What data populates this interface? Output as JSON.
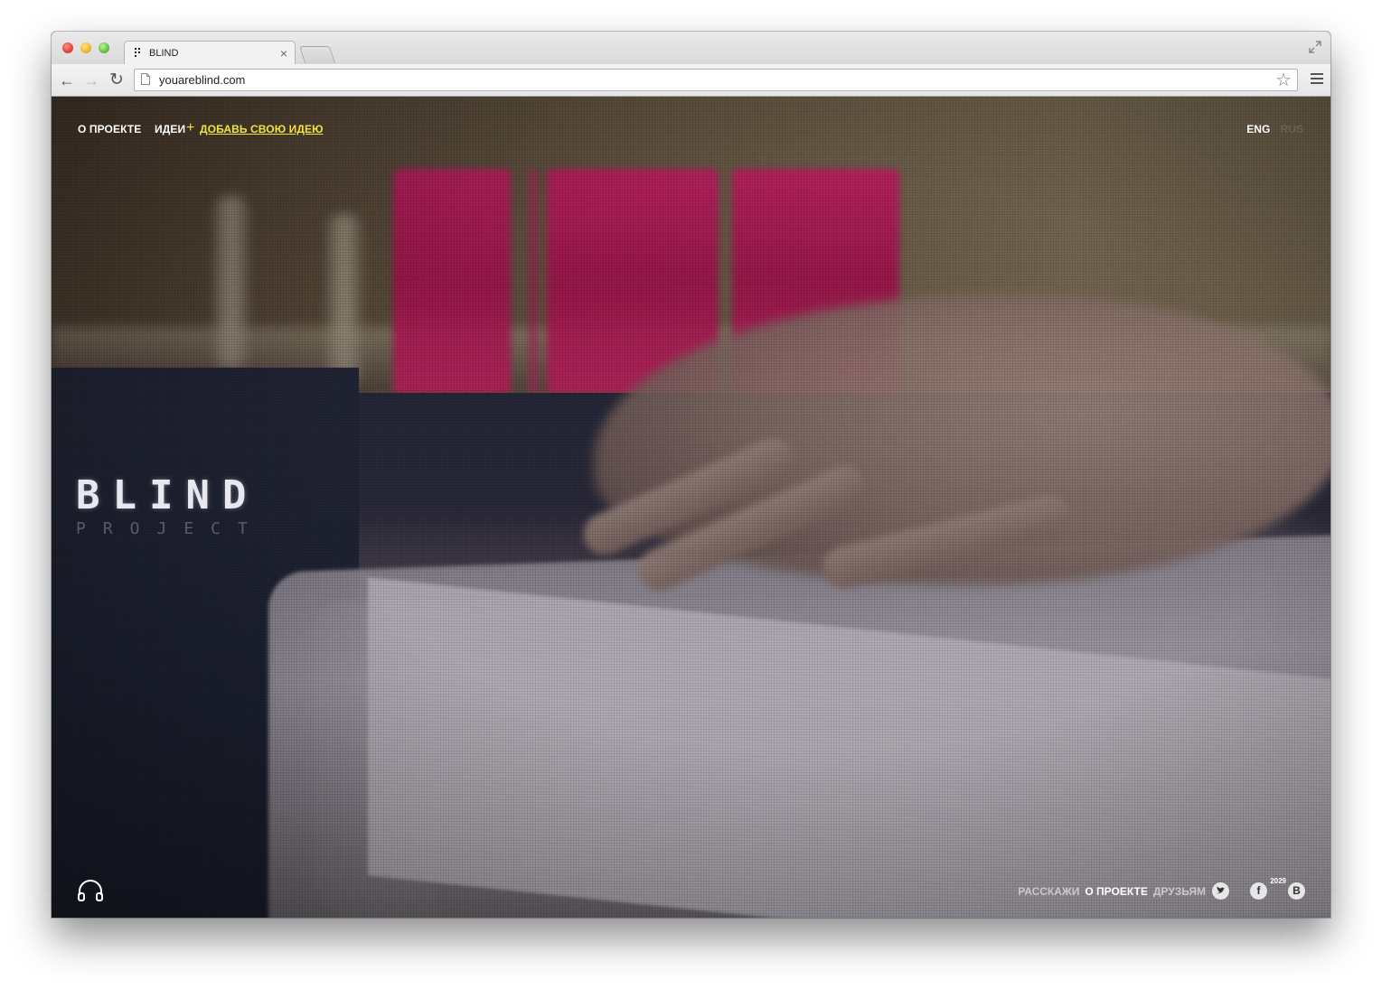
{
  "browser": {
    "tab_title": "BLIND",
    "tab_close": "×",
    "url": "youareblind.com",
    "star": "☆"
  },
  "site": {
    "nav": {
      "about": "О ПРОЕКТЕ",
      "ideas": "ИДЕИ",
      "plus": "+",
      "add_idea": "ДОБАВЬ СВОЮ ИДЕЮ"
    },
    "lang": {
      "eng": "ENG",
      "rus": "RUS"
    },
    "logo": {
      "title": "BLIND",
      "subtitle": "PROJECT"
    },
    "share": {
      "prefix": "РАССКАЖИ",
      "middle": "О ПРОЕКТЕ",
      "suffix": "ДРУЗЬЯМ",
      "facebook_count": "2029",
      "twitter_icon": "twitter-icon",
      "facebook_icon": "facebook-icon",
      "vk_icon": "vk-icon"
    },
    "colors": {
      "accent": "#f3e33c",
      "neon": "#c61c63"
    }
  }
}
